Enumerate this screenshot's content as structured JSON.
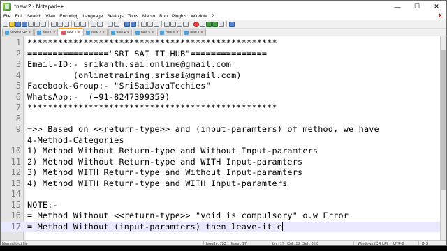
{
  "window": {
    "title": "*new 2 - Notepad++",
    "minimize": "—",
    "maximize": "☐",
    "close": "✕"
  },
  "menu": [
    "File",
    "Edit",
    "Search",
    "View",
    "Encoding",
    "Language",
    "Settings",
    "Tools",
    "Macro",
    "Run",
    "Plugins",
    "Window",
    "?"
  ],
  "menu_close": "X",
  "tabs": [
    {
      "label": "Video7748",
      "active": false
    },
    {
      "label": "new 1",
      "active": false
    },
    {
      "label": "new 2",
      "active": true
    },
    {
      "label": "new 3",
      "active": false
    },
    {
      "label": "new 4",
      "active": false
    },
    {
      "label": "new 5",
      "active": false
    },
    {
      "label": "new 6",
      "active": false
    },
    {
      "label": "new 7",
      "active": false
    }
  ],
  "editor": {
    "lines": [
      {
        "n": "1",
        "text": "*************************************************"
      },
      {
        "n": "2",
        "text": "================\"SRI SAI IT HUB\"==============="
      },
      {
        "n": "3",
        "text": "Email-ID:- srikanth.sai.online@gmail.com"
      },
      {
        "n": "4",
        "text": "         (onlinetraining.srisai@gmail.com)"
      },
      {
        "n": "5",
        "text": "Facebook-Group:- \"SriSaiJavaTechies\""
      },
      {
        "n": "6",
        "text": "WhatsApp:-  (+91-8247399359)"
      },
      {
        "n": "7",
        "text": "*************************************************"
      },
      {
        "n": "8",
        "text": ""
      },
      {
        "n": "9",
        "text": "=>> Based on <<return-type>> and (input-paramters) of method, we have"
      },
      {
        "n": "",
        "text": "4-Method-Categories"
      },
      {
        "n": "10",
        "text": "1) Method Without Return-type and Without Input-paramters"
      },
      {
        "n": "11",
        "text": "2) Method Without Return-type and WITH Input-paramters"
      },
      {
        "n": "12",
        "text": "3) Method WITH Return-type and Without Input-paramters"
      },
      {
        "n": "13",
        "text": "4) Method WITH Return-type and WITH Input-paramters"
      },
      {
        "n": "14",
        "text": ""
      },
      {
        "n": "15",
        "text": "NOTE:-"
      },
      {
        "n": "16",
        "text": "= Method Without <<return-type>> \"void is compulsory\" o.w Error"
      },
      {
        "n": "17",
        "text": "= Method Without (input-paramters) then leave-it e",
        "current": true
      }
    ]
  },
  "status": {
    "file_type": "Normal text file",
    "length": "length : 733",
    "lines": "lines : 17",
    "ln": "Ln : 17",
    "col": "Col : 52",
    "sel": "Sel : 0 | 0",
    "eol": "Windows (CR LF)",
    "encoding": "UTF-8",
    "mode": "INS"
  }
}
